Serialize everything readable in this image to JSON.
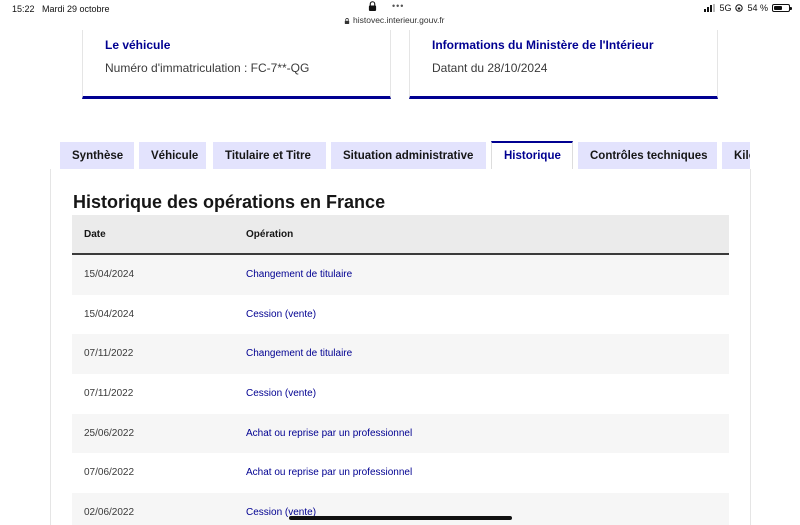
{
  "status_bar": {
    "time": "15:22",
    "date": "Mardi 29 octobre",
    "dots": "•••",
    "url": "histovec.interieur.gouv.fr",
    "network": "5G",
    "battery": "54 %",
    "battery_level": 0.54
  },
  "cards": [
    {
      "title": "Le véhicule",
      "text": "Numéro d'immatriculation : FC-7**-QG"
    },
    {
      "title": "Informations du Ministère de l'Intérieur",
      "text": "Datant du 28/10/2024"
    }
  ],
  "tabs": [
    {
      "label": "Synthèse",
      "active": false
    },
    {
      "label": "Véhicule",
      "active": false
    },
    {
      "label": "Titulaire et Titre",
      "active": false
    },
    {
      "label": "Situation administrative",
      "active": false
    },
    {
      "label": "Historique",
      "active": true
    },
    {
      "label": "Contrôles techniques",
      "active": false
    },
    {
      "label": "Kilométrage",
      "active": false
    }
  ],
  "history": {
    "title": "Historique des opérations en France",
    "columns": [
      "Date",
      "Opération"
    ],
    "rows": [
      {
        "date": "15/04/2024",
        "operation": "Changement de titulaire"
      },
      {
        "date": "15/04/2024",
        "operation": "Cession (vente)"
      },
      {
        "date": "07/11/2022",
        "operation": "Changement de titulaire"
      },
      {
        "date": "07/11/2022",
        "operation": "Cession (vente)"
      },
      {
        "date": "25/06/2022",
        "operation": "Achat ou reprise par un professionnel"
      },
      {
        "date": "07/06/2022",
        "operation": "Achat ou reprise par un professionnel"
      },
      {
        "date": "02/06/2022",
        "operation": "Cession (vente)"
      }
    ]
  },
  "colors": {
    "accent": "#000091",
    "tab_bg": "#e3e3fd",
    "row_alt": "#f6f6f6",
    "header_bg": "#ebebeb"
  }
}
